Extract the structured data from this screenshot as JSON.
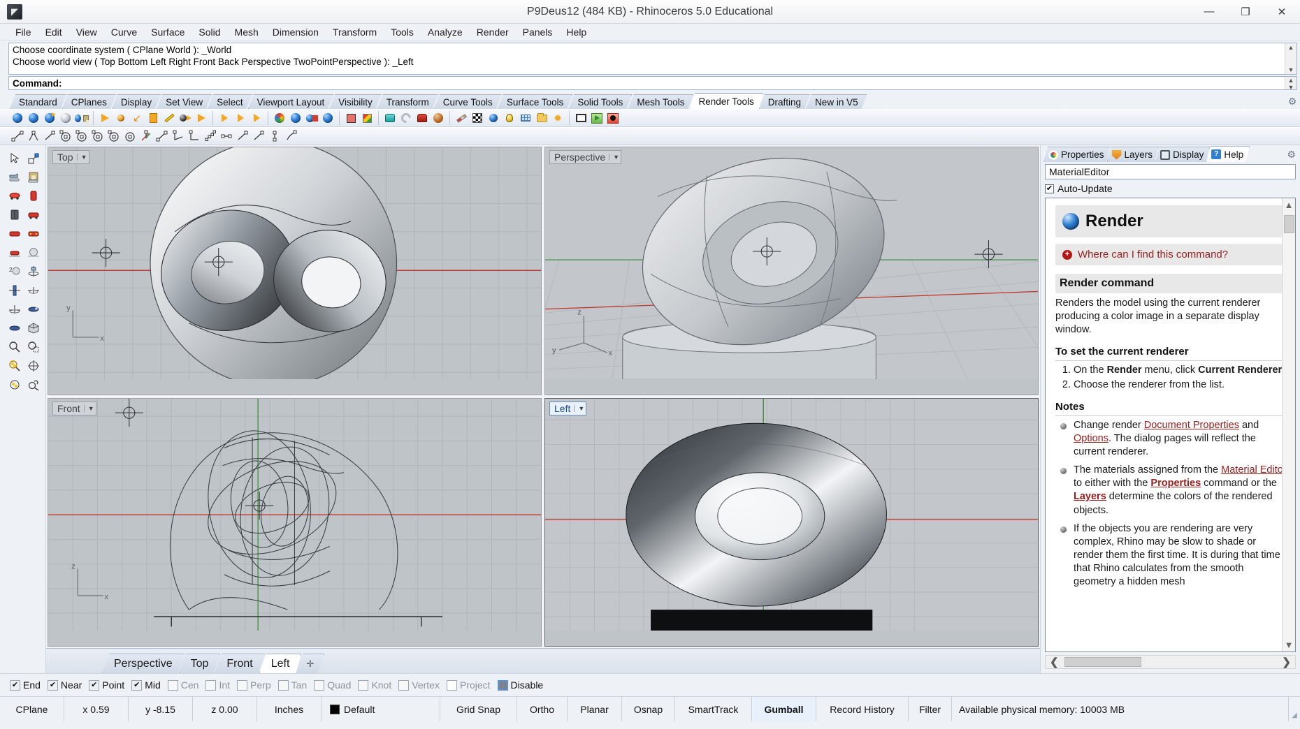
{
  "window": {
    "title": "P9Deus12 (484 KB) - Rhinoceros 5.0 Educational",
    "icon": "rhino-app-icon",
    "minimize": "—",
    "maximize": "❐",
    "close": "✕"
  },
  "menubar": {
    "items": [
      "File",
      "Edit",
      "View",
      "Curve",
      "Surface",
      "Solid",
      "Mesh",
      "Dimension",
      "Transform",
      "Tools",
      "Analyze",
      "Render",
      "Panels",
      "Help"
    ]
  },
  "command_area": {
    "history": [
      "Choose coordinate system ( CPlane  World ): _World",
      "Choose world view ( Top  Bottom  Left  Right  Front  Back  Perspective  TwoPointPerspective ): _Left"
    ],
    "prompt": "Command:",
    "input_value": ""
  },
  "toolbar_tabs": {
    "items": [
      "Standard",
      "CPlanes",
      "Display",
      "Set View",
      "Select",
      "Viewport Layout",
      "Visibility",
      "Transform",
      "Curve Tools",
      "Surface Tools",
      "Solid Tools",
      "Mesh Tools",
      "Render Tools",
      "Drafting",
      "New in V5"
    ],
    "active": "Render Tools"
  },
  "toolbar_icons_row1": [
    {
      "name": "render-icon",
      "glyph": "ball"
    },
    {
      "name": "render-preview-icon",
      "glyph": "ball-grey"
    },
    {
      "name": "render-in-window-icon",
      "glyph": "ball-arrow"
    },
    {
      "name": "render-mesh-icon",
      "glyph": "ball-wire"
    },
    {
      "name": "save-render-icon",
      "glyph": "ball-floppy"
    },
    {
      "sep": true
    },
    {
      "name": "spotlight-icon",
      "glyph": "tri"
    },
    {
      "name": "point-light-icon",
      "glyph": "ball-orange"
    },
    {
      "name": "directional-light-icon",
      "glyph": "arrow-dl"
    },
    {
      "name": "rectangular-light-icon",
      "glyph": "sq"
    },
    {
      "name": "linear-light-icon",
      "glyph": "pencil"
    },
    {
      "name": "sun-icon",
      "glyph": "ball-dark-arrow"
    },
    {
      "name": "spot-light-2-icon",
      "glyph": "tri2"
    },
    {
      "sep": true
    },
    {
      "name": "light-properties-icon",
      "glyph": "tri-orbit"
    },
    {
      "name": "light-direction-icon",
      "glyph": "tri-orbit2"
    },
    {
      "name": "light-edit-icon",
      "glyph": "tri-eye"
    },
    {
      "sep": true
    },
    {
      "name": "material-sphere-icon",
      "glyph": "ball-multi"
    },
    {
      "name": "material-assign-icon",
      "glyph": "ball-swap"
    },
    {
      "name": "material-paint-icon",
      "glyph": "ball-paint"
    },
    {
      "name": "material-match-icon",
      "glyph": "ball-match"
    },
    {
      "sep": true
    },
    {
      "name": "render-properties-icon",
      "glyph": "mesh-pts"
    },
    {
      "name": "texture-mapping-icon",
      "glyph": "cube"
    },
    {
      "sep": true
    },
    {
      "name": "environment-icon",
      "glyph": "cup"
    },
    {
      "name": "ground-plane-icon",
      "glyph": "swirl"
    },
    {
      "name": "decal-icon",
      "glyph": "mailbox"
    },
    {
      "name": "bump-texture-icon",
      "glyph": "planet"
    },
    {
      "sep": true
    },
    {
      "name": "paint-brush-icon",
      "glyph": "brush"
    },
    {
      "name": "checker-texture-icon",
      "glyph": "checker"
    },
    {
      "name": "sphere-preview-icon",
      "glyph": "ball-blue-sm"
    },
    {
      "name": "light-bulb-icon",
      "glyph": "bulb"
    },
    {
      "name": "render-grid-icon",
      "glyph": "gridsm"
    },
    {
      "name": "open-folder-icon",
      "glyph": "folder"
    },
    {
      "name": "sun-burst-icon",
      "glyph": "star"
    },
    {
      "sep": true
    },
    {
      "name": "animation-icon",
      "glyph": "film"
    },
    {
      "name": "play-animation-icon",
      "glyph": "play"
    },
    {
      "name": "record-icon",
      "glyph": "rec"
    }
  ],
  "toolbar_icons_row2": [
    {
      "name": "line-icon"
    },
    {
      "name": "polyline-icon"
    },
    {
      "name": "line-segment-icon"
    },
    {
      "name": "circle-center-icon"
    },
    {
      "name": "circle-diameter-icon"
    },
    {
      "name": "circle-3pt-icon"
    },
    {
      "name": "circle-tangent-icon"
    },
    {
      "name": "circle-around-curve-icon"
    },
    {
      "name": "arc-center-icon"
    },
    {
      "name": "arc-3pt-icon"
    },
    {
      "name": "angle-icon"
    },
    {
      "name": "angle-2-icon"
    },
    {
      "name": "point-cloud-icon"
    },
    {
      "name": "dimension-icon"
    },
    {
      "name": "polyline-2-icon"
    },
    {
      "name": "curve-icon"
    },
    {
      "name": "point-icon"
    },
    {
      "name": "sphere-tool-icon"
    }
  ],
  "left_toolbar": [
    {
      "name": "select-arrow-icon"
    },
    {
      "name": "select-window-icon"
    },
    {
      "name": "open-file-icon"
    },
    {
      "name": "save-file-icon"
    },
    {
      "name": "perspective-view-icon"
    },
    {
      "name": "front-view-icon"
    },
    {
      "name": "side-view-icon"
    },
    {
      "name": "right-view-icon"
    },
    {
      "name": "top-view-icon"
    },
    {
      "name": "back-view-icon"
    },
    {
      "name": "bottom-view-icon"
    },
    {
      "name": "shaded-sphere-icon"
    },
    {
      "name": "two-point-perspective-icon"
    },
    {
      "name": "set-cplane-icon"
    },
    {
      "name": "cplane-origin-icon"
    },
    {
      "name": "cplane-to-object-icon"
    },
    {
      "name": "cplane-world-icon"
    },
    {
      "name": "named-cplane-icon"
    },
    {
      "name": "plane-through-pts-icon"
    },
    {
      "name": "bounding-box-icon"
    },
    {
      "name": "zoom-icon"
    },
    {
      "name": "zoom-window-icon"
    },
    {
      "name": "zoom-selected-icon"
    },
    {
      "name": "zoom-target-icon"
    },
    {
      "name": "zoom-extents-icon"
    },
    {
      "name": "zoom-previous-icon"
    }
  ],
  "viewports": [
    {
      "name": "viewport-top",
      "label": "Top",
      "active": false,
      "position": "top-left"
    },
    {
      "name": "viewport-perspective",
      "label": "Perspective",
      "active": false,
      "position": "top-right"
    },
    {
      "name": "viewport-front",
      "label": "Front",
      "active": false,
      "position": "bottom-left"
    },
    {
      "name": "viewport-left",
      "label": "Left",
      "active": true,
      "position": "bottom-right"
    }
  ],
  "viewport_tabs": {
    "items": [
      "Perspective",
      "Top",
      "Front",
      "Left"
    ],
    "active": "Left",
    "add_label": "✛"
  },
  "right_panel": {
    "tabs": [
      {
        "label": "Properties",
        "icon": "properties-icon",
        "active": false
      },
      {
        "label": "Layers",
        "icon": "layers-icon",
        "active": false
      },
      {
        "label": "Display",
        "icon": "display-icon",
        "active": false
      },
      {
        "label": "Help",
        "icon": "help-icon",
        "active": true
      }
    ],
    "gear": "⚙",
    "search_value": "MaterialEditor",
    "search_placeholder": "",
    "auto_update_label": "Auto-Update",
    "auto_update_checked": true,
    "checkmark": "✔",
    "help": {
      "title": "Render",
      "find_link": "Where can I find this command?",
      "find_icon": "⊕",
      "section_command": "Render command",
      "paragraph": "Renders the model using the current renderer producing a color image in a separate display window.",
      "section_set": "To set the current renderer",
      "steps": [
        {
          "pre": "On the ",
          "bold": "Render",
          "mid": " menu, click ",
          "bold2": "Current Renderer",
          "post": "."
        },
        {
          "pre": "Choose the renderer from the list.",
          "bold": "",
          "mid": "",
          "bold2": "",
          "post": ""
        }
      ],
      "section_notes": "Notes",
      "notes": [
        "Change render Document Properties and Options. The dialog pages will reflect the current renderer.",
        "The materials assigned from the Material Editor to either with the Properties command or the Layers determine the colors of the rendered objects.",
        "If the objects you are rendering are very complex, Rhino may be slow to shade or render them the first time. It is during that time that Rhino calculates from the smooth geometry a hidden mesh"
      ]
    },
    "scroll": {
      "up": "▲",
      "down": "▼",
      "left": "❮",
      "right": "❯"
    }
  },
  "osnap_bar": {
    "items": [
      {
        "label": "End",
        "checked": true
      },
      {
        "label": "Near",
        "checked": true
      },
      {
        "label": "Point",
        "checked": true
      },
      {
        "label": "Mid",
        "checked": true
      },
      {
        "label": "Cen",
        "checked": false
      },
      {
        "label": "Int",
        "checked": false
      },
      {
        "label": "Perp",
        "checked": false
      },
      {
        "label": "Tan",
        "checked": false
      },
      {
        "label": "Quad",
        "checked": false
      },
      {
        "label": "Knot",
        "checked": false
      },
      {
        "label": "Vertex",
        "checked": false
      },
      {
        "label": "Project",
        "checked": false
      },
      {
        "label": "Disable",
        "checked": false,
        "disabled_style": true
      }
    ],
    "checkmark": "✔"
  },
  "status_bar": {
    "cplane": "CPlane",
    "x": "x 0.59",
    "y": "y -8.15",
    "z": "z 0.00",
    "units": "Inches",
    "layer": "Default",
    "layer_color": "#000000",
    "toggles": [
      {
        "label": "Grid Snap",
        "active": false
      },
      {
        "label": "Ortho",
        "active": false
      },
      {
        "label": "Planar",
        "active": false
      },
      {
        "label": "Osnap",
        "active": false
      },
      {
        "label": "SmartTrack",
        "active": false
      },
      {
        "label": "Gumball",
        "active": true
      },
      {
        "label": "Record History",
        "active": false
      },
      {
        "label": "Filter",
        "active": false
      }
    ],
    "memory": "Available physical memory: 10003 MB"
  },
  "colors": {
    "accent": "#2f7fd4",
    "link": "#9a2020",
    "viewport_bg": "#bfc4c9",
    "chrome": "#eef1f6"
  }
}
